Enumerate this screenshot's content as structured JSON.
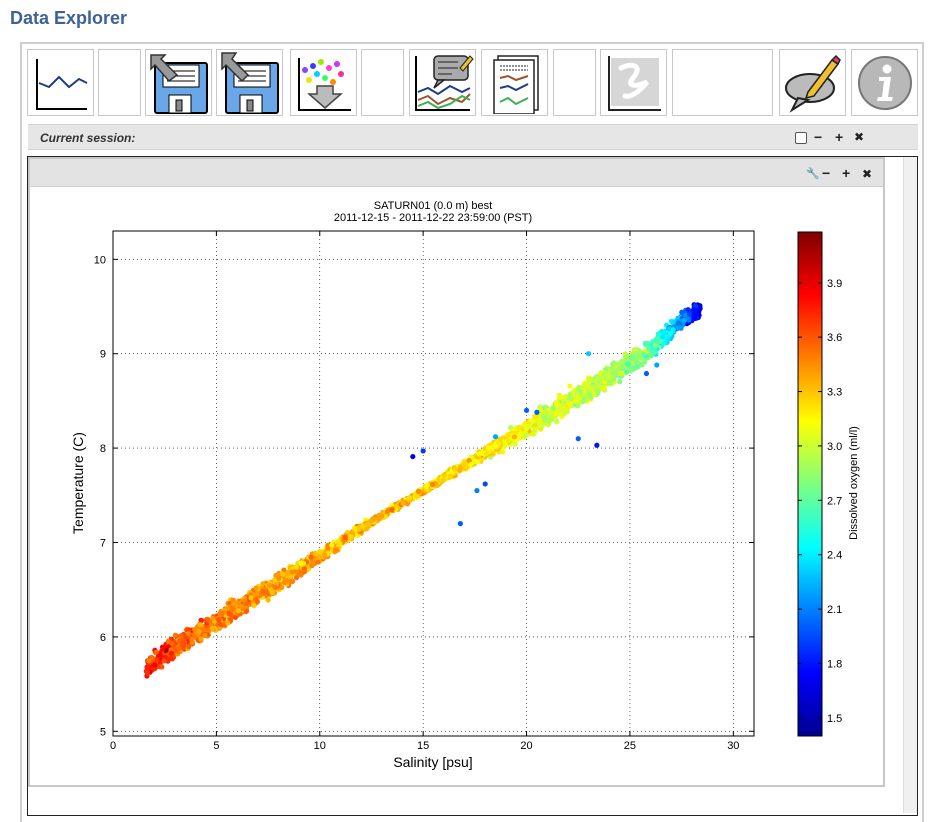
{
  "app": {
    "title": "Data Explorer"
  },
  "toolbar": {
    "buttons": [
      {
        "name": "line-plot-button",
        "icon": "line-chart-icon"
      },
      {
        "name": "blank-button-1",
        "icon": ""
      },
      {
        "name": "save-session-button",
        "icon": "save-in-icon"
      },
      {
        "name": "load-session-button",
        "icon": "save-out-icon"
      },
      {
        "name": "scatter-download-button",
        "icon": "scatter-download-icon"
      },
      {
        "name": "blank-button-2",
        "icon": ""
      },
      {
        "name": "annotate-plot-button",
        "icon": "annotate-chart-icon"
      },
      {
        "name": "report-button",
        "icon": "report-icon"
      },
      {
        "name": "blank-button-3",
        "icon": ""
      },
      {
        "name": "scribble-button",
        "icon": "scribble-icon"
      },
      {
        "name": "blank-button-4",
        "icon": ""
      },
      {
        "name": "comment-button",
        "icon": "comment-pencil-icon"
      },
      {
        "name": "info-button",
        "icon": "info-icon"
      }
    ]
  },
  "session": {
    "title": "Current session:",
    "controls": {
      "minimize": "−",
      "add": "+",
      "close": "✖"
    }
  },
  "plot_panel": {
    "controls": {
      "settings": "🔧",
      "minimize": "−",
      "add": "+",
      "close": "✖"
    }
  },
  "chart_data": {
    "type": "scatter",
    "title": "SATURN01 (0.0 m) best",
    "subtitle": "2011-12-15 - 2011-12-22 23:59:00 (PST)",
    "xlabel": "Salinity [psu]",
    "ylabel": "Temperature (C)",
    "xlim": [
      0,
      31
    ],
    "ylim": [
      4.95,
      10.3
    ],
    "xticks": [
      0,
      5,
      10,
      15,
      20,
      25,
      30
    ],
    "yticks": [
      5,
      6,
      7,
      8,
      9,
      10
    ],
    "grid": true,
    "colorbar": {
      "label": "Dissolved oxygen (ml/l)",
      "range": [
        1.4,
        4.18
      ],
      "ticks": [
        1.5,
        1.8,
        2.1,
        2.4,
        2.7,
        3.0,
        3.3,
        3.6,
        3.9
      ],
      "colormap": "jet"
    },
    "trend_points": [
      {
        "x": 1.6,
        "y": 5.68,
        "c": 3.7
      },
      {
        "x": 2.5,
        "y": 5.82,
        "c": 3.75
      },
      {
        "x": 3.0,
        "y": 5.9,
        "c": 3.6
      },
      {
        "x": 5.0,
        "y": 6.15,
        "c": 3.5
      },
      {
        "x": 7.0,
        "y": 6.45,
        "c": 3.45
      },
      {
        "x": 10.0,
        "y": 6.85,
        "c": 3.35
      },
      {
        "x": 12.0,
        "y": 7.15,
        "c": 3.3
      },
      {
        "x": 15.0,
        "y": 7.55,
        "c": 3.3
      },
      {
        "x": 18.0,
        "y": 7.95,
        "c": 3.2
      },
      {
        "x": 21.0,
        "y": 8.35,
        "c": 3.05
      },
      {
        "x": 24.0,
        "y": 8.75,
        "c": 2.95
      },
      {
        "x": 26.0,
        "y": 9.05,
        "c": 2.75
      },
      {
        "x": 27.5,
        "y": 9.35,
        "c": 2.1
      },
      {
        "x": 28.4,
        "y": 9.48,
        "c": 1.7
      }
    ],
    "outliers": [
      {
        "x": 23.4,
        "y": 8.03,
        "c": 1.8
      },
      {
        "x": 22.5,
        "y": 8.1,
        "c": 2.0
      },
      {
        "x": 20.0,
        "y": 8.4,
        "c": 2.0
      },
      {
        "x": 18.5,
        "y": 8.12,
        "c": 2.2
      },
      {
        "x": 15.0,
        "y": 7.97,
        "c": 1.9
      },
      {
        "x": 14.5,
        "y": 7.91,
        "c": 1.7
      },
      {
        "x": 16.8,
        "y": 7.2,
        "c": 2.0
      },
      {
        "x": 18.0,
        "y": 7.62,
        "c": 1.95
      },
      {
        "x": 17.6,
        "y": 7.55,
        "c": 2.1
      },
      {
        "x": 20.5,
        "y": 8.38,
        "c": 2.0
      },
      {
        "x": 26.3,
        "y": 8.88,
        "c": 2.2
      },
      {
        "x": 25.8,
        "y": 8.79,
        "c": 2.0
      },
      {
        "x": 23.0,
        "y": 9.0,
        "c": 2.3
      }
    ]
  }
}
